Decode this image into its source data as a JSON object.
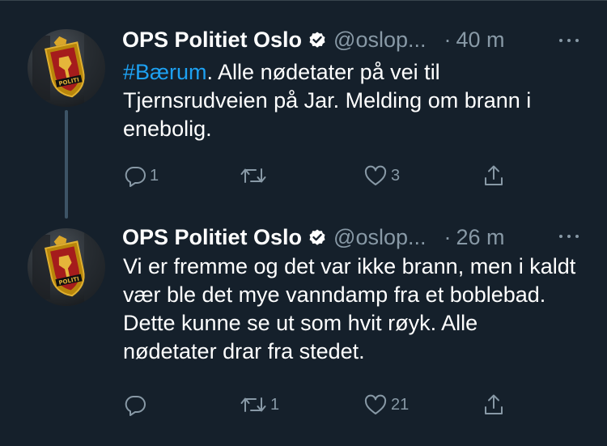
{
  "tweets": [
    {
      "name": "OPS Politiet Oslo",
      "handle": "@oslop...",
      "separator": "·",
      "time": "40 m",
      "hashtag": "#Bærum",
      "text": ". Alle nødetater på vei til Tjernsrudveien på Jar. Melding om brann i enebolig.",
      "replies": "1",
      "retweets": "",
      "likes": "3"
    },
    {
      "name": "OPS Politiet Oslo",
      "handle": "@oslop...",
      "separator": "·",
      "time": "26 m",
      "text": "Vi er fremme og det var ikke brann, men i kaldt vær ble det mye vanndamp fra et boblebad. Dette kunne se ut som hvit røyk. Alle nødetater drar fra stedet.",
      "replies": "",
      "retweets": "1",
      "likes": "21"
    }
  ],
  "avatar": {
    "badge_text": "POLITI"
  },
  "colors": {
    "background": "#15202b",
    "primary_text": "#ffffff",
    "secondary_text": "#8899a6",
    "link": "#1da1f2",
    "thread_line": "#3d5466"
  },
  "icons": [
    "verified-badge-icon",
    "more-icon",
    "reply-icon",
    "retweet-icon",
    "like-icon",
    "share-icon"
  ]
}
